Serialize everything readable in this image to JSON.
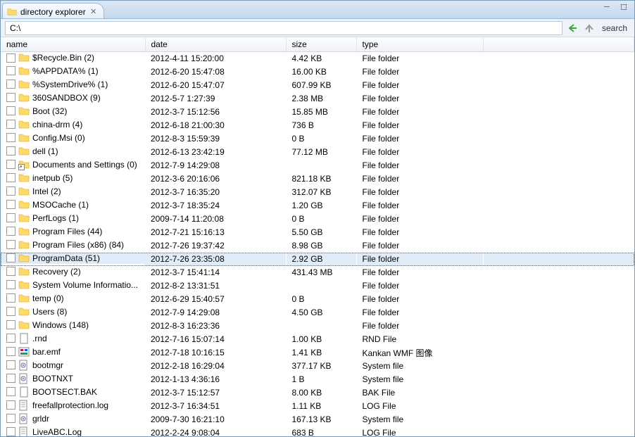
{
  "tab": {
    "title": "directory explorer"
  },
  "address": {
    "path": "C:\\",
    "search_label": "search"
  },
  "columns": {
    "name": "name",
    "date": "date",
    "size": "size",
    "type": "type"
  },
  "col_widths": {
    "name": 205,
    "date": 200,
    "size": 100,
    "type": 180
  },
  "selected_index": 15,
  "hover_index": 8,
  "rows": [
    {
      "icon": "folder",
      "name": "$Recycle.Bin (2)",
      "date": "2012-4-11 15:20:00",
      "size": "4.42 KB",
      "type": "File folder"
    },
    {
      "icon": "folder",
      "name": "%APPDATA% (1)",
      "date": "2012-6-20 15:47:08",
      "size": "16.00 KB",
      "type": "File folder"
    },
    {
      "icon": "folder",
      "name": "%SystemDrive% (1)",
      "date": "2012-6-20 15:47:07",
      "size": "607.99 KB",
      "type": "File folder"
    },
    {
      "icon": "folder",
      "name": "360SANDBOX (9)",
      "date": "2012-5-7 1:27:39",
      "size": "2.38 MB",
      "type": "File folder"
    },
    {
      "icon": "folder",
      "name": "Boot (32)",
      "date": "2012-3-7 15:12:56",
      "size": "15.85 MB",
      "type": "File folder"
    },
    {
      "icon": "folder",
      "name": "china-drm (4)",
      "date": "2012-6-18 21:00:30",
      "size": "736 B",
      "type": "File folder"
    },
    {
      "icon": "folder",
      "name": "Config.Msi (0)",
      "date": "2012-8-3 15:59:39",
      "size": "0 B",
      "type": "File folder"
    },
    {
      "icon": "folder",
      "name": "dell (1)",
      "date": "2012-6-13 23:42:19",
      "size": "77.12 MB",
      "type": "File folder"
    },
    {
      "icon": "shortcut",
      "name": "Documents and Settings (0)",
      "date": "2012-7-9 14:29:08",
      "size": "",
      "type": "File folder"
    },
    {
      "icon": "folder",
      "name": "inetpub (5)",
      "date": "2012-3-6 20:16:06",
      "size": "821.18 KB",
      "type": "File folder"
    },
    {
      "icon": "folder",
      "name": "Intel (2)",
      "date": "2012-3-7 16:35:20",
      "size": "312.07 KB",
      "type": "File folder"
    },
    {
      "icon": "folder",
      "name": "MSOCache (1)",
      "date": "2012-3-7 18:35:24",
      "size": "1.20 GB",
      "type": "File folder"
    },
    {
      "icon": "folder",
      "name": "PerfLogs (1)",
      "date": "2009-7-14 11:20:08",
      "size": "0 B",
      "type": "File folder"
    },
    {
      "icon": "folder",
      "name": "Program Files (44)",
      "date": "2012-7-21 15:16:13",
      "size": "5.50 GB",
      "type": "File folder"
    },
    {
      "icon": "folder",
      "name": "Program Files (x86) (84)",
      "date": "2012-7-26 19:37:42",
      "size": "8.98 GB",
      "type": "File folder"
    },
    {
      "icon": "folder",
      "name": "ProgramData (51)",
      "date": "2012-7-26 23:35:08",
      "size": "2.92 GB",
      "type": "File folder"
    },
    {
      "icon": "folder",
      "name": "Recovery (2)",
      "date": "2012-3-7 15:41:14",
      "size": "431.43 MB",
      "type": "File folder"
    },
    {
      "icon": "folder",
      "name": "System Volume Informatio...",
      "date": "2012-8-2 13:31:51",
      "size": "",
      "type": "File folder"
    },
    {
      "icon": "folder",
      "name": "temp (0)",
      "date": "2012-6-29 15:40:57",
      "size": "0 B",
      "type": "File folder"
    },
    {
      "icon": "folder",
      "name": "Users (8)",
      "date": "2012-7-9 14:29:08",
      "size": "4.50 GB",
      "type": "File folder"
    },
    {
      "icon": "folder",
      "name": "Windows (148)",
      "date": "2012-8-3 16:23:36",
      "size": "",
      "type": "File folder"
    },
    {
      "icon": "file",
      "name": ".rnd",
      "date": "2012-7-16 15:07:14",
      "size": "1.00 KB",
      "type": "RND File"
    },
    {
      "icon": "wmf",
      "name": "bar.emf",
      "date": "2012-7-18 10:16:15",
      "size": "1.41 KB",
      "type": "Kankan WMF 图像"
    },
    {
      "icon": "sys",
      "name": "bootmgr",
      "date": "2012-2-18 16:29:04",
      "size": "377.17 KB",
      "type": "System file"
    },
    {
      "icon": "sys",
      "name": "BOOTNXT",
      "date": "2012-1-13 4:36:16",
      "size": "1 B",
      "type": "System file"
    },
    {
      "icon": "file",
      "name": "BOOTSECT.BAK",
      "date": "2012-3-7 15:12:57",
      "size": "8.00 KB",
      "type": "BAK File"
    },
    {
      "icon": "log",
      "name": "freefallprotection.log",
      "date": "2012-3-7 16:34:51",
      "size": "1.11 KB",
      "type": "LOG File"
    },
    {
      "icon": "sys",
      "name": "grldr",
      "date": "2009-7-30 16:21:10",
      "size": "167.13 KB",
      "type": "System file"
    },
    {
      "icon": "log",
      "name": "LiveABC.Log",
      "date": "2012-2-24 9:08:04",
      "size": "683 B",
      "type": "LOG File"
    }
  ]
}
